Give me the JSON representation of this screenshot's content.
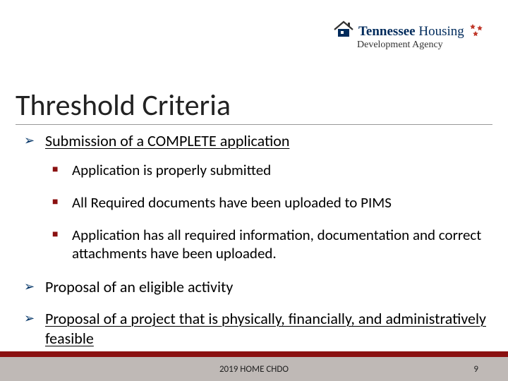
{
  "logo": {
    "brand_bold": "Tennessee",
    "brand_rest": " Housing",
    "subline": "Development Agency",
    "house_color": "#002b5c",
    "roof_color": "#333333",
    "star_color": "#c0392b"
  },
  "title": "Threshold Criteria",
  "bullets": {
    "b1": "Submission of a COMPLETE application",
    "b1_sub": [
      "Application is properly submitted",
      "All Required documents have been uploaded to PIMS",
      "Application has all required information, documentation and correct attachments have been uploaded."
    ],
    "b2": "Proposal of an eligible activity",
    "b3": "Proposal of a project that is physically, financially, and administratively feasible"
  },
  "footer": {
    "center": "2019 HOME CHDO",
    "page": "9"
  }
}
